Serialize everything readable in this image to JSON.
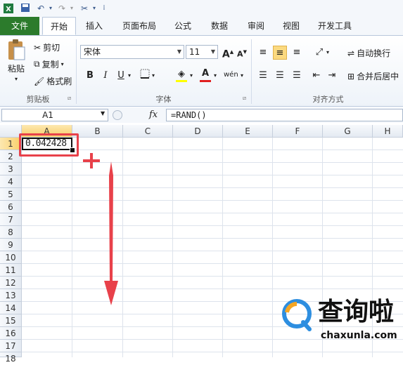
{
  "tabs": [
    "文件",
    "开始",
    "插入",
    "页面布局",
    "公式",
    "数据",
    "审阅",
    "视图",
    "开发工具"
  ],
  "clipboard": {
    "paste": "粘贴",
    "cut": "剪切",
    "copy": "复制",
    "format_painter": "格式刷",
    "group_label": "剪贴板"
  },
  "font": {
    "name": "宋体",
    "size": "11",
    "bold": "B",
    "italic": "I",
    "underline": "U",
    "group_label": "字体",
    "grow": "A",
    "shrink": "A",
    "fill_color": "#ffff00",
    "font_color": "#e02020"
  },
  "alignment": {
    "wrap_text": "自动换行",
    "merge_center": "合并后居中",
    "group_label": "对齐方式"
  },
  "name_box": "A1",
  "fx": "fx",
  "formula": "=RAND()",
  "columns": [
    "A",
    "B",
    "C",
    "D",
    "E",
    "F",
    "G",
    "H"
  ],
  "rows": [
    "1",
    "2",
    "3",
    "4",
    "5",
    "6",
    "7",
    "8",
    "9",
    "10",
    "11",
    "12",
    "13",
    "14",
    "15",
    "16",
    "17",
    "18"
  ],
  "cell_a1": "0.042428",
  "fill_handle_cursor": "+",
  "watermark": {
    "brand": "查询啦",
    "domain": "chaxunla.com"
  },
  "colors": {
    "file_tab": "#2c7b2c",
    "annotation_red": "#e8414a",
    "selection": "#f8cf6a"
  }
}
